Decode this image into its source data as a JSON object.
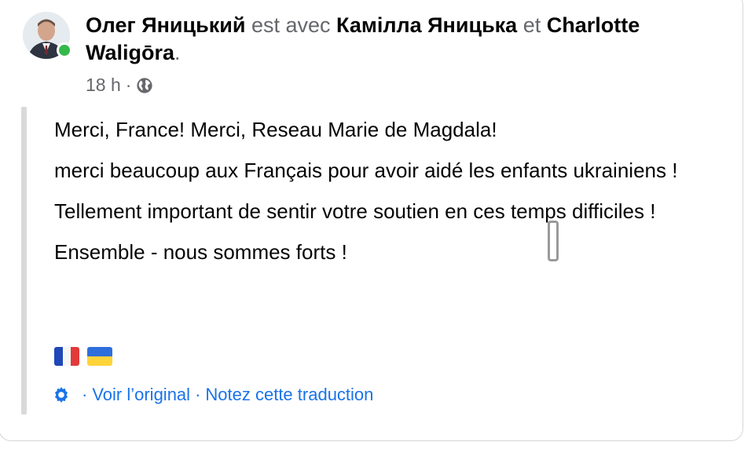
{
  "post": {
    "author": "Олег Яницький",
    "with_word": "est avec",
    "tagged_1": "Камілла Яницька",
    "and_word": "et",
    "tagged_2": "Charlotte Waligōra",
    "end_punct": ".",
    "time": "18 h",
    "dot": "·",
    "privacy_icon": "globe-icon",
    "avatar_icon": "avatar",
    "online_color": "#35b84a"
  },
  "content": {
    "p1": "Merci, France! Merci, Reseau Marie de Magdala!",
    "p2": "merci beaucoup aux Français pour avoir aidé les enfants ukrainiens !",
    "p3": "Tellement important de sentir votre soutien en ces temps difficiles !",
    "p4": "Ensemble - nous sommes forts !",
    "flags": [
      "flag-france",
      "flag-ukraine"
    ]
  },
  "translation": {
    "icon": "gear-icon",
    "sep1": "·",
    "view_original": "Voir l’original",
    "sep2": "·",
    "rate": "Notez cette traduction"
  },
  "colors": {
    "link": "#1a73e8",
    "muted": "#65676b",
    "quote_bar": "#d9d9d9"
  }
}
